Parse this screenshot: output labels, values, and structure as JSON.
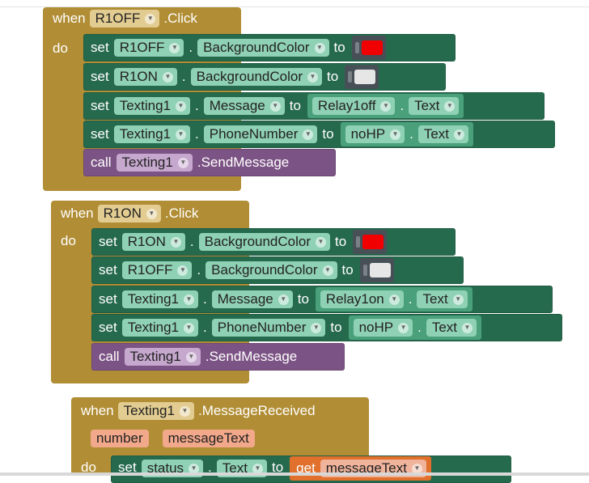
{
  "kw": {
    "when": "when",
    "do": "do",
    "set": "set",
    "call": "call",
    "to": "to",
    "get": "get",
    "dot": "."
  },
  "colors": {
    "red": "#f00000",
    "white": "#e6e6e6"
  },
  "block1": {
    "component": "R1OFF",
    "event": ".Click",
    "rows": [
      {
        "comp": "R1OFF",
        "prop": "BackgroundColor",
        "value_kind": "color",
        "value": "red"
      },
      {
        "comp": "R1ON",
        "prop": "BackgroundColor",
        "value_kind": "color",
        "value": "white"
      },
      {
        "comp": "Texting1",
        "prop": "Message",
        "value_comp": "Relay1off",
        "value_prop": "Text"
      },
      {
        "comp": "Texting1",
        "prop": "PhoneNumber",
        "value_comp": "noHP",
        "value_prop": "Text"
      }
    ],
    "call": {
      "comp": "Texting1",
      "method": ".SendMessage"
    }
  },
  "block2": {
    "component": "R1ON",
    "event": ".Click",
    "rows": [
      {
        "comp": "R1ON",
        "prop": "BackgroundColor",
        "value_kind": "color",
        "value": "red"
      },
      {
        "comp": "R1OFF",
        "prop": "BackgroundColor",
        "value_kind": "color",
        "value": "white"
      },
      {
        "comp": "Texting1",
        "prop": "Message",
        "value_comp": "Relay1on",
        "value_prop": "Text"
      },
      {
        "comp": "Texting1",
        "prop": "PhoneNumber",
        "value_comp": "noHP",
        "value_prop": "Text"
      }
    ],
    "call": {
      "comp": "Texting1",
      "method": ".SendMessage"
    }
  },
  "block3": {
    "component": "Texting1",
    "event": ".MessageReceived",
    "params": [
      "number",
      "messageText"
    ],
    "row": {
      "comp": "status",
      "prop": "Text",
      "get_var": "messageText"
    }
  }
}
